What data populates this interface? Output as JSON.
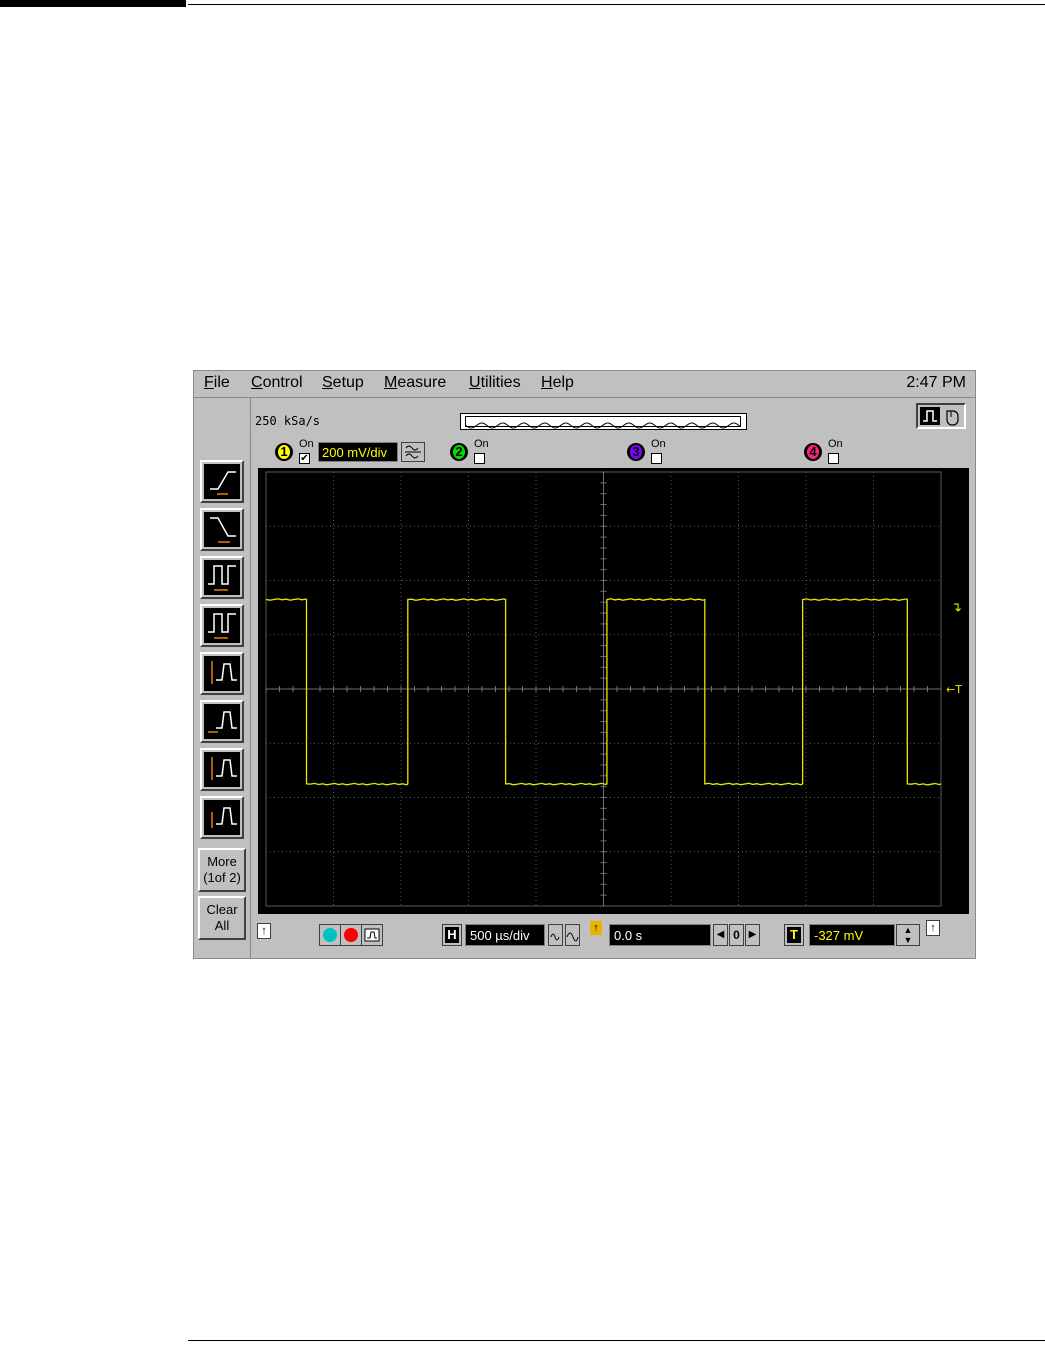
{
  "menu": {
    "items": [
      {
        "label": "File",
        "u": "F",
        "rest": "ile"
      },
      {
        "label": "Control",
        "u": "C",
        "rest": "ontrol"
      },
      {
        "label": "Setup",
        "u": "S",
        "rest": "etup"
      },
      {
        "label": "Measure",
        "u": "M",
        "rest": "easure"
      },
      {
        "label": "Utilities",
        "u": "U",
        "rest": "tilities"
      },
      {
        "label": "Help",
        "u": "H",
        "rest": "elp"
      }
    ],
    "clock": "2:47 PM"
  },
  "acquisition": {
    "sample_rate": "250 kSa/s"
  },
  "channels": [
    {
      "number": "1",
      "on_label": "On",
      "checked": true,
      "checkmark": "✔",
      "scale": "200 mV/div",
      "color": "#ffff00"
    },
    {
      "number": "2",
      "on_label": "On",
      "checked": false,
      "checkmark": "",
      "color": "#00e000"
    },
    {
      "number": "3",
      "on_label": "On",
      "checked": false,
      "checkmark": "",
      "color": "#8000ff"
    },
    {
      "number": "4",
      "on_label": "On",
      "checked": false,
      "checkmark": "",
      "color": "#ff2080"
    }
  ],
  "measure_toolbar": {
    "tools": [
      "rise-time",
      "fall-time",
      "period",
      "frequency",
      "peak-to-peak",
      "average",
      "amplitude",
      "top"
    ],
    "more_label_line1": "More",
    "more_label_line2": "(1of 2)",
    "clear_label_line1": "Clear",
    "clear_label_line2": "All"
  },
  "horizontal": {
    "letter": "H",
    "timebase": "500 µs/div",
    "delay": "0.0 s",
    "ref_label": "0"
  },
  "trigger": {
    "letter": "T",
    "level": "-327 mV",
    "level_marker": "←T",
    "edge_marker": "↴"
  },
  "colors": {
    "trace": "#e8e800",
    "grid": "#5a5a5a",
    "screen": "#000000",
    "panel": "#c0c0c0",
    "run_cyan": "#00c0c0",
    "stop_red": "#ff0000"
  },
  "chart_data": {
    "type": "line",
    "title": "",
    "xlabel": "",
    "ylabel": "",
    "grid": true,
    "x_unit_per_div": "500 µs/div",
    "y_unit_per_div": "200 mV/div",
    "divisions": {
      "x": 10,
      "y": 8
    },
    "series": [
      {
        "x": [
          0,
          0.6,
          0.6,
          2.1,
          2.1,
          3.55,
          3.55,
          5.05,
          5.05,
          6.5,
          6.5,
          7.95,
          7.95,
          9.5,
          9.5,
          10
        ],
        "y": [
          1.65,
          1.65,
          -1.75,
          -1.75,
          1.65,
          1.65,
          -1.75,
          -1.75,
          1.65,
          1.65,
          -1.75,
          -1.75,
          1.65,
          1.65,
          -1.75,
          -1.75
        ]
      }
    ]
  }
}
